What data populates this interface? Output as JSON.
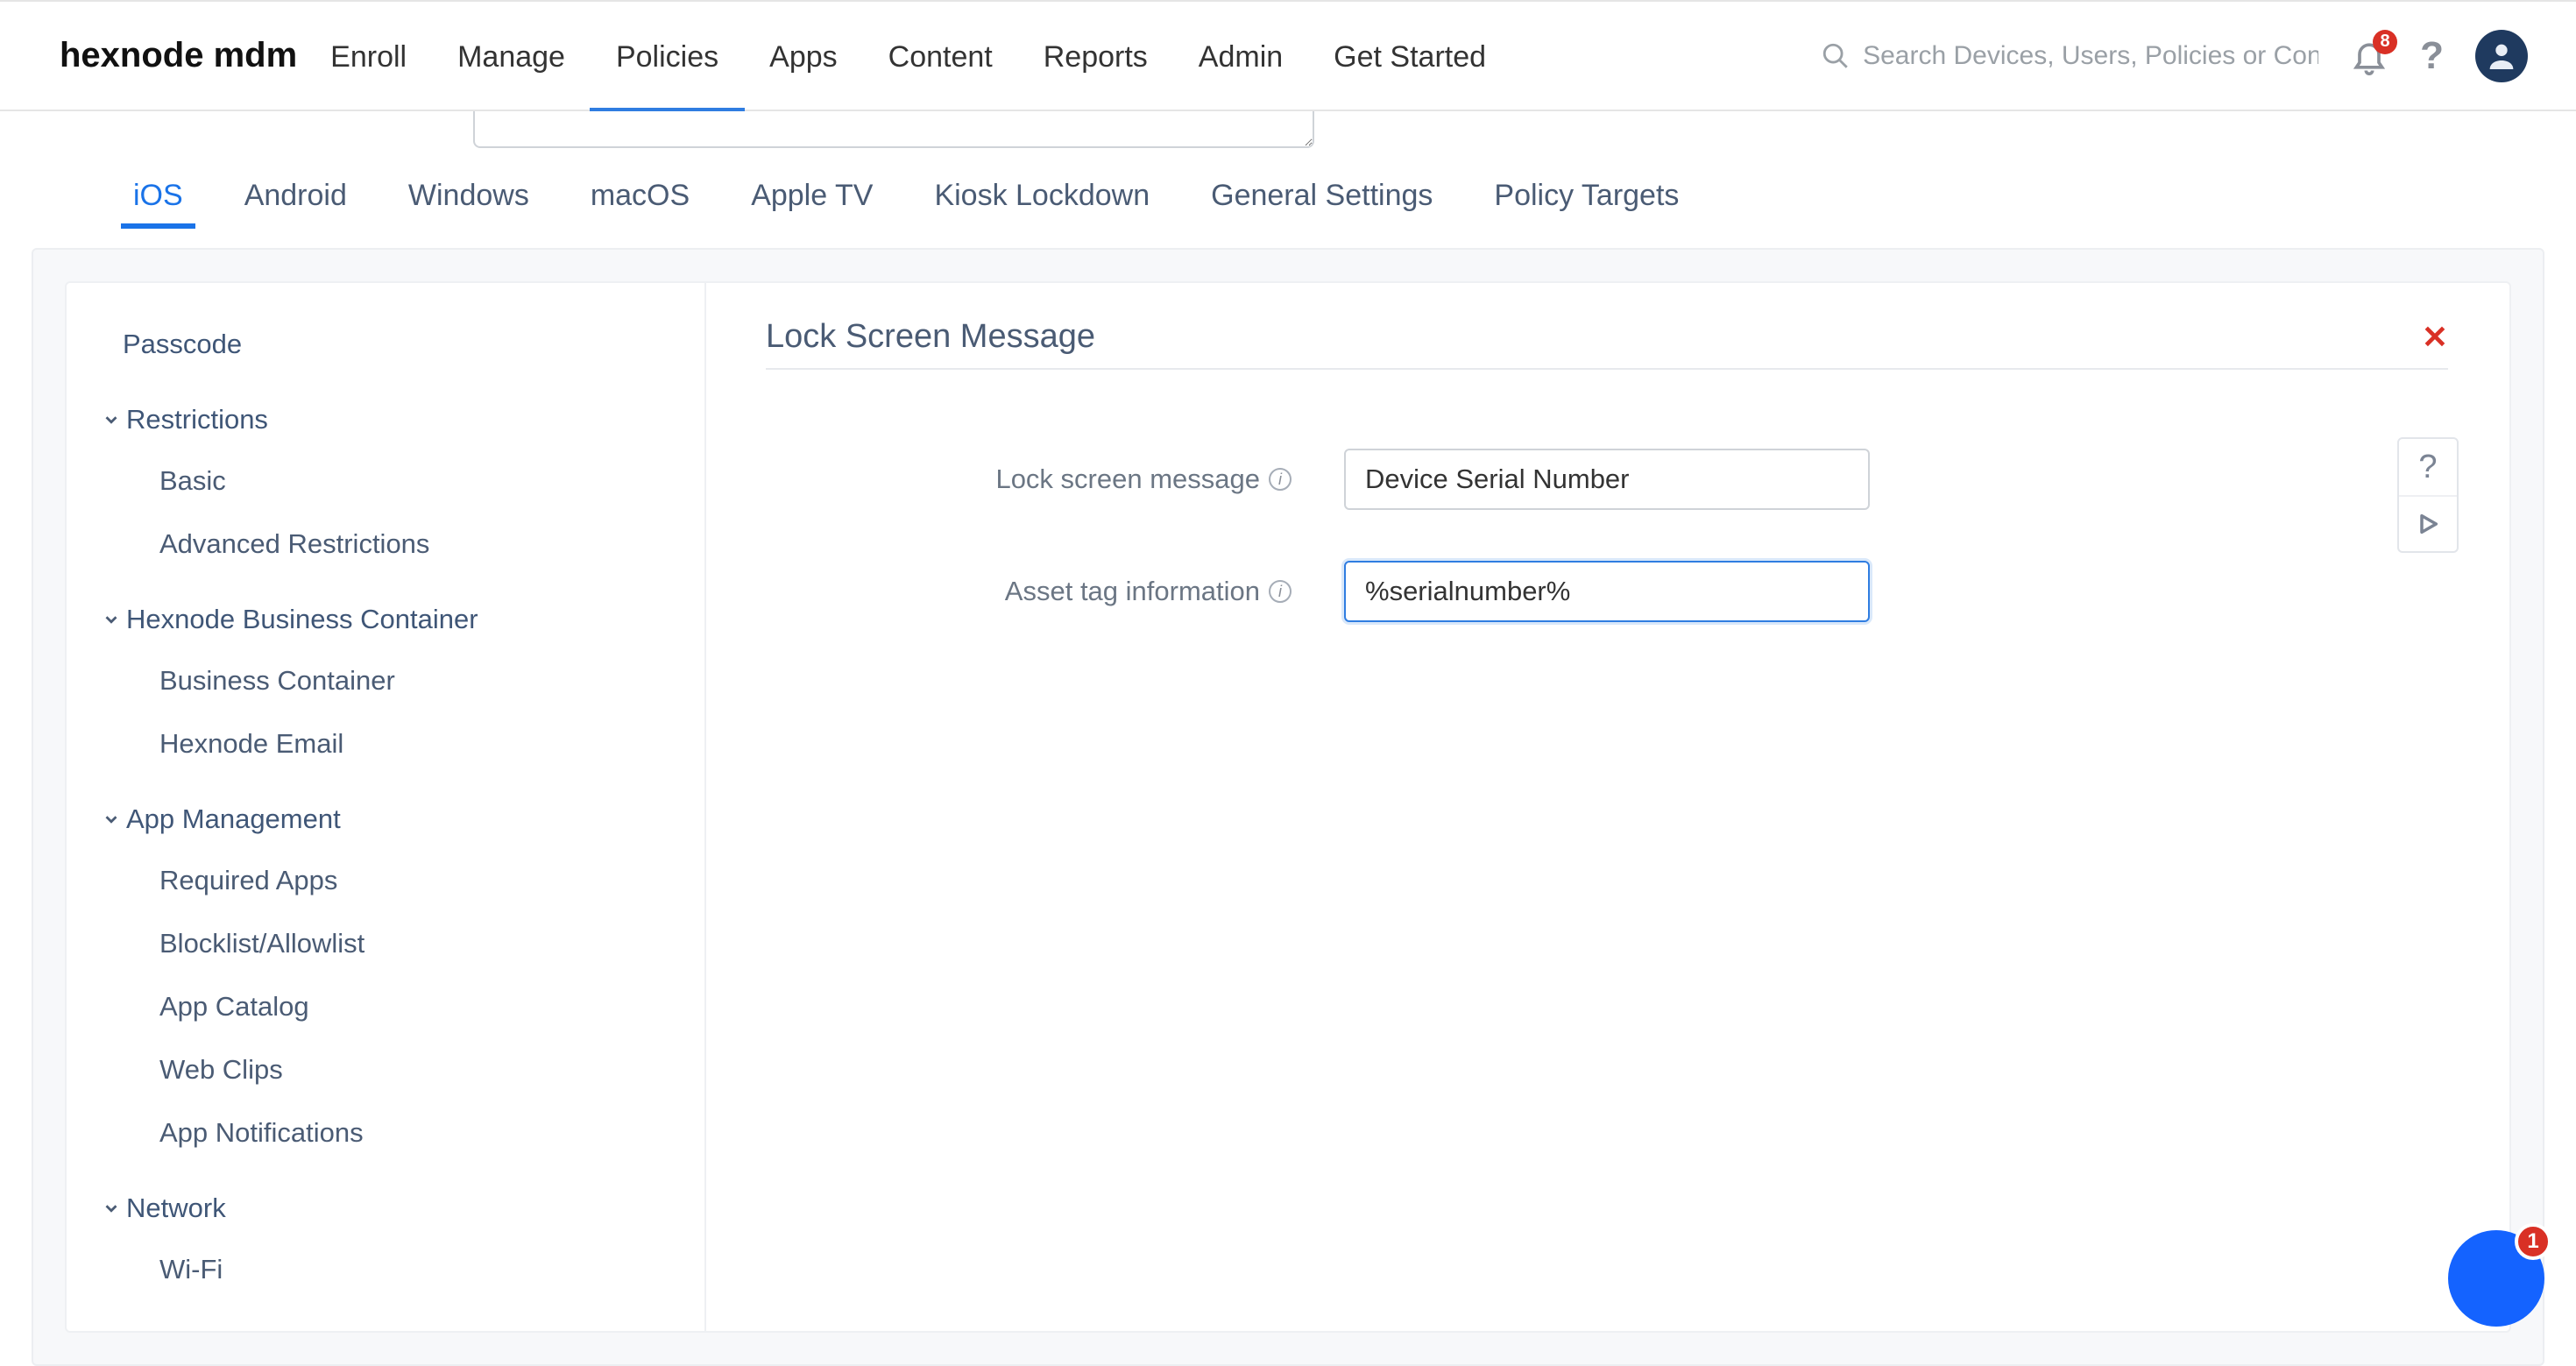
{
  "brand": {
    "logo_text": "hexnode mdm"
  },
  "topnav": {
    "items": [
      "Enroll",
      "Manage",
      "Policies",
      "Apps",
      "Content",
      "Reports",
      "Admin",
      "Get Started"
    ],
    "active_index": 2
  },
  "search": {
    "placeholder": "Search Devices, Users, Policies or Content"
  },
  "notifications": {
    "count": "8"
  },
  "tabs": {
    "items": [
      "iOS",
      "Android",
      "Windows",
      "macOS",
      "Apple TV",
      "Kiosk Lockdown",
      "General Settings",
      "Policy Targets"
    ],
    "active_index": 0
  },
  "sidebar": {
    "top_link": "Passcode",
    "groups": [
      {
        "title": "Restrictions",
        "items": [
          "Basic",
          "Advanced Restrictions"
        ]
      },
      {
        "title": "Hexnode Business Container",
        "items": [
          "Business Container",
          "Hexnode Email"
        ]
      },
      {
        "title": "App Management",
        "items": [
          "Required Apps",
          "Blocklist/Allowlist",
          "App Catalog",
          "Web Clips",
          "App Notifications"
        ]
      },
      {
        "title": "Network",
        "items": [
          "Wi-Fi"
        ]
      }
    ]
  },
  "section": {
    "title": "Lock Screen Message",
    "fields": {
      "lock_screen_message": {
        "label": "Lock screen message",
        "value": "Device Serial Number"
      },
      "asset_tag": {
        "label": "Asset tag information",
        "value": "%serialnumber%"
      }
    }
  },
  "chat": {
    "badge": "1"
  }
}
